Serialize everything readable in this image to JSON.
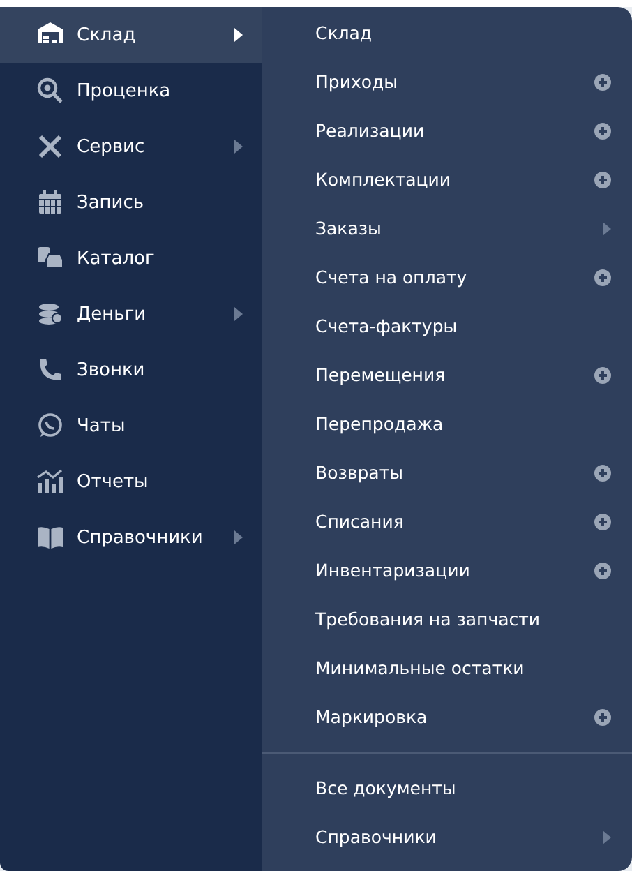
{
  "sidebar": {
    "items": [
      {
        "label": "Склад",
        "selected": true,
        "has_submenu": true
      },
      {
        "label": "Проценка",
        "selected": false,
        "has_submenu": false
      },
      {
        "label": "Сервис",
        "selected": false,
        "has_submenu": true
      },
      {
        "label": "Запись",
        "selected": false,
        "has_submenu": false
      },
      {
        "label": "Каталог",
        "selected": false,
        "has_submenu": false
      },
      {
        "label": "Деньги",
        "selected": false,
        "has_submenu": true
      },
      {
        "label": "Звонки",
        "selected": false,
        "has_submenu": false
      },
      {
        "label": "Чаты",
        "selected": false,
        "has_submenu": false
      },
      {
        "label": "Отчеты",
        "selected": false,
        "has_submenu": false
      },
      {
        "label": "Справочники",
        "selected": false,
        "has_submenu": true
      }
    ]
  },
  "submenu": {
    "items": [
      {
        "label": "Склад",
        "kind": "plain"
      },
      {
        "label": "Приходы",
        "kind": "add"
      },
      {
        "label": "Реализации",
        "kind": "add"
      },
      {
        "label": "Комплектации",
        "kind": "add"
      },
      {
        "label": "Заказы",
        "kind": "submenu"
      },
      {
        "label": "Счета на оплату",
        "kind": "add"
      },
      {
        "label": "Счета-фактуры",
        "kind": "plain"
      },
      {
        "label": "Перемещения",
        "kind": "add"
      },
      {
        "label": "Перепродажа",
        "kind": "plain"
      },
      {
        "label": "Возвраты",
        "kind": "add"
      },
      {
        "label": "Списания",
        "kind": "add"
      },
      {
        "label": "Инвентаризации",
        "kind": "add"
      },
      {
        "label": "Требования на запчасти",
        "kind": "plain"
      },
      {
        "label": "Минимальные остатки",
        "kind": "plain"
      },
      {
        "label": "Маркировка",
        "kind": "add"
      }
    ],
    "footer_items": [
      {
        "label": "Все документы",
        "kind": "plain"
      },
      {
        "label": "Справочники",
        "kind": "submenu"
      }
    ]
  }
}
